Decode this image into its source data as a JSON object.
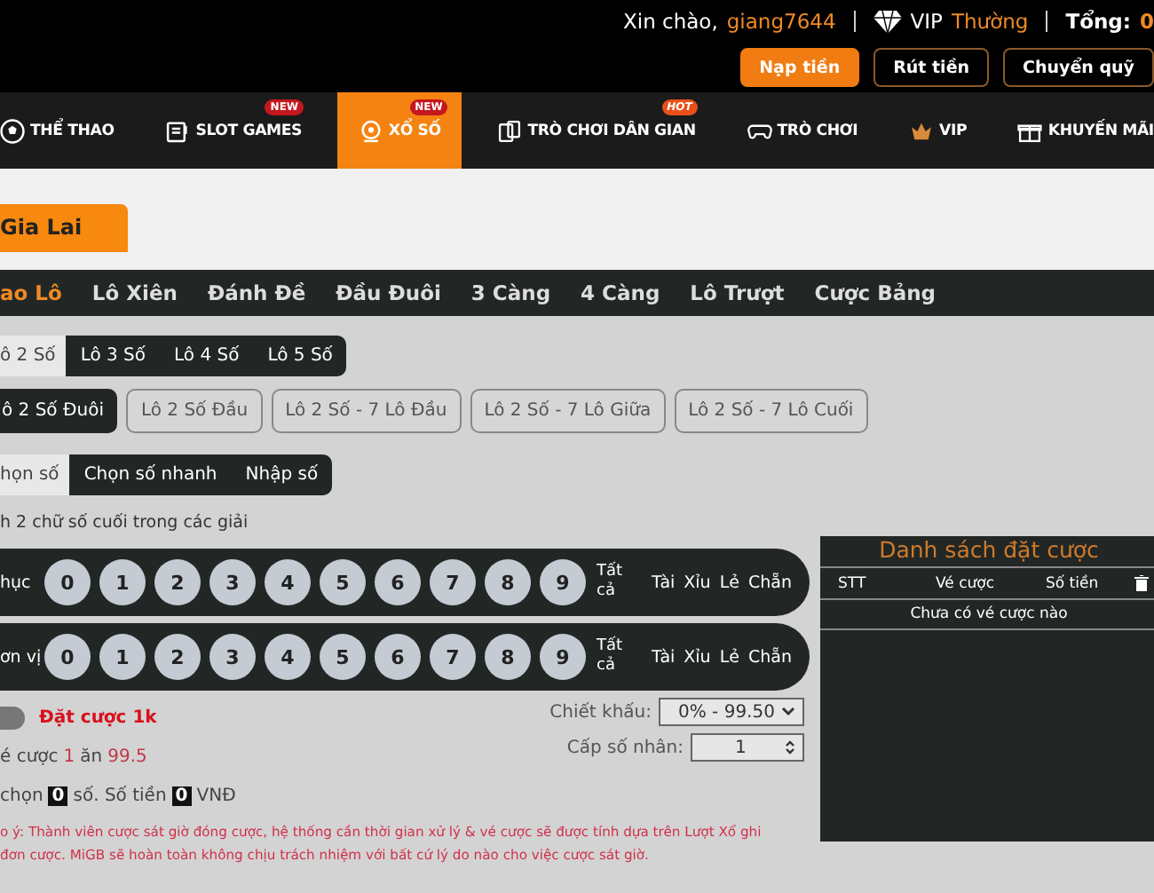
{
  "header": {
    "greeting": "Xin chào,",
    "username": "giang7644",
    "vip_label": "VIP",
    "vip_level": "Thường",
    "total_label": "Tổng:",
    "total_value": "0",
    "buttons": [
      {
        "label": "Nạp tiền",
        "kind": "primary"
      },
      {
        "label": "Rút tiền",
        "kind": "outline"
      },
      {
        "label": "Chuyển quỹ",
        "kind": "outline"
      }
    ]
  },
  "nav": [
    {
      "label": "THỂ THAO",
      "selected": false
    },
    {
      "label": "SLOT GAMES",
      "badge": "NEW",
      "selected": false
    },
    {
      "label": "XỔ SỐ",
      "badge": "NEW",
      "selected": true
    },
    {
      "label": "TRÒ CHƠI DÂN GIAN",
      "badge": "HOT",
      "selected": false
    },
    {
      "label": "TRÒ CHƠI",
      "selected": false
    },
    {
      "label": "VIP",
      "selected": false
    },
    {
      "label": "KHUYẾN MÃI",
      "selected": false
    }
  ],
  "region_tab": {
    "label": "Gia Lai",
    "selected": true
  },
  "bet_types": [
    {
      "label": "ao Lô",
      "selected": true
    },
    {
      "label": "Lô Xiên",
      "selected": false
    },
    {
      "label": "Đánh Đề",
      "selected": false
    },
    {
      "label": "Đầu Đuôi",
      "selected": false
    },
    {
      "label": "3 Càng",
      "selected": false
    },
    {
      "label": "4 Càng",
      "selected": false
    },
    {
      "label": "Lô Trượt",
      "selected": false
    },
    {
      "label": "Cược Bảng",
      "selected": false
    }
  ],
  "lo_types": [
    {
      "label": "ô 2 Số",
      "selected": true
    },
    {
      "label": "Lô 3 Số",
      "selected": false
    },
    {
      "label": "Lô 4 Số",
      "selected": false
    },
    {
      "label": "Lô 5 Số",
      "selected": false
    }
  ],
  "lo_subtypes": [
    {
      "label": "ô 2 Số Đuôi",
      "selected": true
    },
    {
      "label": "Lô 2 Số Đầu",
      "selected": false
    },
    {
      "label": "Lô 2 Số - 7 Lô Đầu",
      "selected": false
    },
    {
      "label": "Lô 2 Số - 7 Lô Giữa",
      "selected": false
    },
    {
      "label": "Lô 2 Số - 7 Lô Cuối",
      "selected": false
    }
  ],
  "pick_modes": [
    {
      "label": "họn số",
      "selected": true
    },
    {
      "label": "Chọn số nhanh",
      "selected": false
    },
    {
      "label": "Nhập số",
      "selected": false
    }
  ],
  "hint": "h 2 chữ số cuối trong các giải",
  "digit_rows": [
    {
      "label": "hục",
      "digits": [
        "0",
        "1",
        "2",
        "3",
        "4",
        "5",
        "6",
        "7",
        "8",
        "9"
      ],
      "all_label": "Tất cả",
      "quick": [
        "Tài",
        "Xỉu",
        "Lẻ",
        "Chẵn"
      ]
    },
    {
      "label": "ơn vị",
      "digits": [
        "0",
        "1",
        "2",
        "3",
        "4",
        "5",
        "6",
        "7",
        "8",
        "9"
      ],
      "all_label": "Tất cả",
      "quick": [
        "Tài",
        "Xỉu",
        "Lẻ",
        "Chẵn"
      ]
    }
  ],
  "quick_bet": {
    "label": "Đặt cược 1k",
    "on": false
  },
  "odds": {
    "prefix": "é cược",
    "stake": "1",
    "mid": "ăn",
    "payout": "99.5"
  },
  "summary": {
    "prefix": "chọn",
    "count": "0",
    "mid": "số. Số tiền",
    "amount": "0",
    "suffix": "VNĐ"
  },
  "discount": {
    "label": "Chiết khấu:",
    "value": "0% - 99.50"
  },
  "multiplier": {
    "label": "Cấp số nhân:",
    "value": "1"
  },
  "notice": [
    "o ý: Thành viên cược sát giờ đóng cược, hệ thống cần thời gian xử lý & vé cược sẽ được tính dựa trên Lượt Xổ ghi",
    "đơn cược. MiGB sẽ hoàn toàn không chịu trách nhiệm với bất cứ lý do nào cho việc cược sát giờ."
  ],
  "bet_list": {
    "title": "Danh sách đặt cược",
    "columns": [
      "STT",
      "Vé cược",
      "Số tiền"
    ],
    "empty": "Chưa có vé cược nào"
  }
}
